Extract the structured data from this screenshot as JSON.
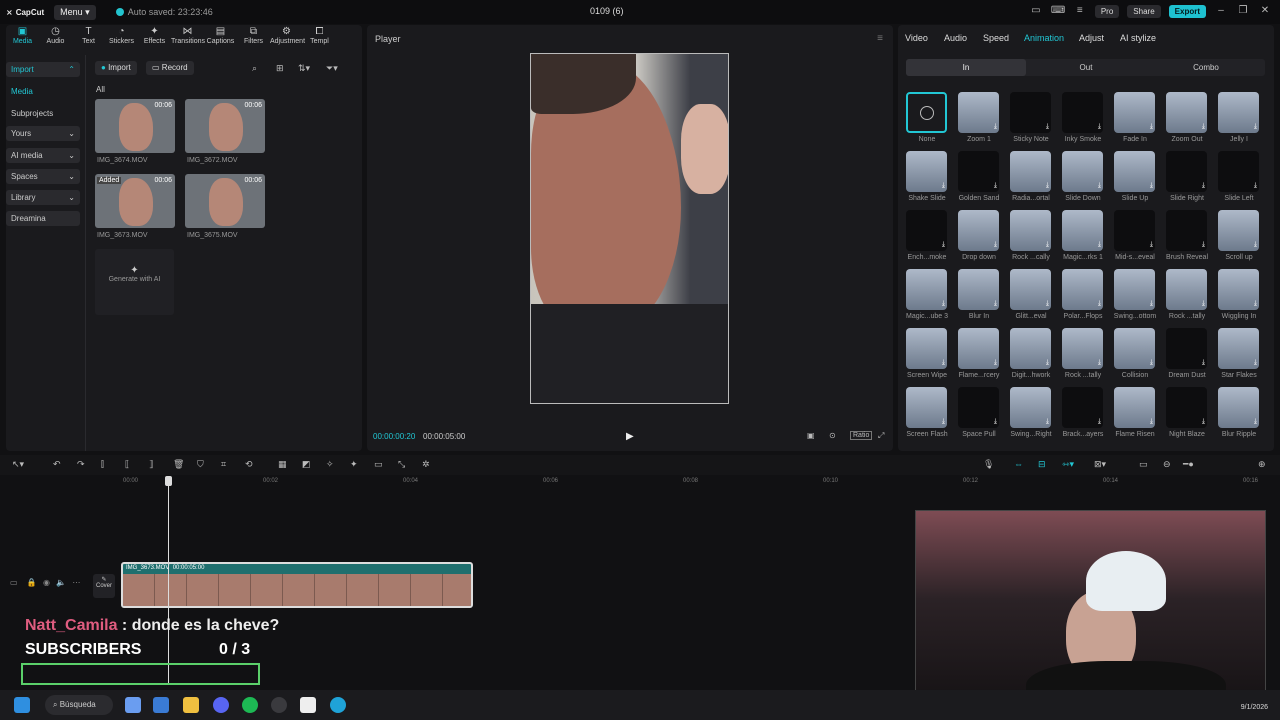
{
  "topbar": {
    "logo": "CapCut",
    "menu": "Menu",
    "autosave": "Auto saved: 23:23:46",
    "project": "0109 (6)",
    "pro": "Pro",
    "share": "Share",
    "export": "Export"
  },
  "tools": [
    {
      "label": "Media",
      "icon": "media-icon"
    },
    {
      "label": "Audio",
      "icon": "audio-icon"
    },
    {
      "label": "Text",
      "icon": "text-icon"
    },
    {
      "label": "Stickers",
      "icon": "stickers-icon"
    },
    {
      "label": "Effects",
      "icon": "effects-icon"
    },
    {
      "label": "Transitions",
      "icon": "transitions-icon"
    },
    {
      "label": "Captions",
      "icon": "captions-icon"
    },
    {
      "label": "Filters",
      "icon": "filters-icon"
    },
    {
      "label": "Adjustment",
      "icon": "adjustment-icon"
    },
    {
      "label": "Templ",
      "icon": "templates-icon"
    }
  ],
  "nav": {
    "import": "Import",
    "media": "Media",
    "subprojects": "Subprojects",
    "yours": "Yours",
    "ai_media": "AI media",
    "spaces": "Spaces",
    "library": "Library",
    "dreamina": "Dreamina"
  },
  "media": {
    "import_btn": "Import",
    "record_btn": "Record",
    "all": "All",
    "items": [
      {
        "name": "IMG_3674.MOV",
        "duration": "00:06",
        "added": ""
      },
      {
        "name": "IMG_3672.MOV",
        "duration": "00:06",
        "added": ""
      },
      {
        "name": "IMG_3673.MOV",
        "duration": "00:06",
        "added": "Added"
      },
      {
        "name": "IMG_3675.MOV",
        "duration": "00:06",
        "added": ""
      }
    ],
    "generate": "Generate with AI"
  },
  "player": {
    "title": "Player",
    "current_time": "00:00:00:20",
    "total_time": "00:00:05:00",
    "ratio": "Ratio"
  },
  "right": {
    "tabs": [
      "Video",
      "Audio",
      "Speed",
      "Animation",
      "Adjust",
      "AI stylize"
    ],
    "active_tab": "Animation",
    "segments": [
      "In",
      "Out",
      "Combo"
    ],
    "animations": [
      "None",
      "Zoom 1",
      "Sticky Note",
      "Inky Smoke",
      "Fade In",
      "Zoom Out",
      "Jelly I",
      "Shake Slide",
      "Golden Sand",
      "Radia...ortal",
      "Slide Down",
      "Slide Up",
      "Slide Right",
      "Slide Left",
      "Ench...moke",
      "Drop down",
      "Rock ...cally",
      "Magic...rks 1",
      "Mid-s...eveal",
      "Brush Reveal",
      "Scroll up",
      "Magic...ube 3",
      "Blur In",
      "Glitt...eval",
      "Polar...Flops",
      "Swing...ottom",
      "Rock ...tally",
      "Wiggling In",
      "Screen Wipe",
      "Flame...rcery",
      "Digit...hwork",
      "Rock ...tally",
      "Collision",
      "Dream Dust",
      "Star Flakes",
      "Screen Flash",
      "Space Pull",
      "Swing...Right",
      "Brack...ayers",
      "Flame Risen",
      "Night Blaze",
      "Blur Ripple"
    ]
  },
  "timeline": {
    "ticks": [
      "00:00",
      "00:02",
      "00:04",
      "00:06",
      "00:08",
      "00:10",
      "00:12",
      "00:14",
      "00:16"
    ],
    "clip_name": "IMG_3673.MOV",
    "clip_duration": "00:00:05:00",
    "cover": "Cover"
  },
  "overlay": {
    "user": "Natt_Camila",
    "message": " : donde es la cheve?",
    "subs_label": "SUBSCRIBERS",
    "subs_count": "0  / 3"
  },
  "taskbar": {
    "search": "Búsqueda",
    "date": "9/1/2026"
  }
}
